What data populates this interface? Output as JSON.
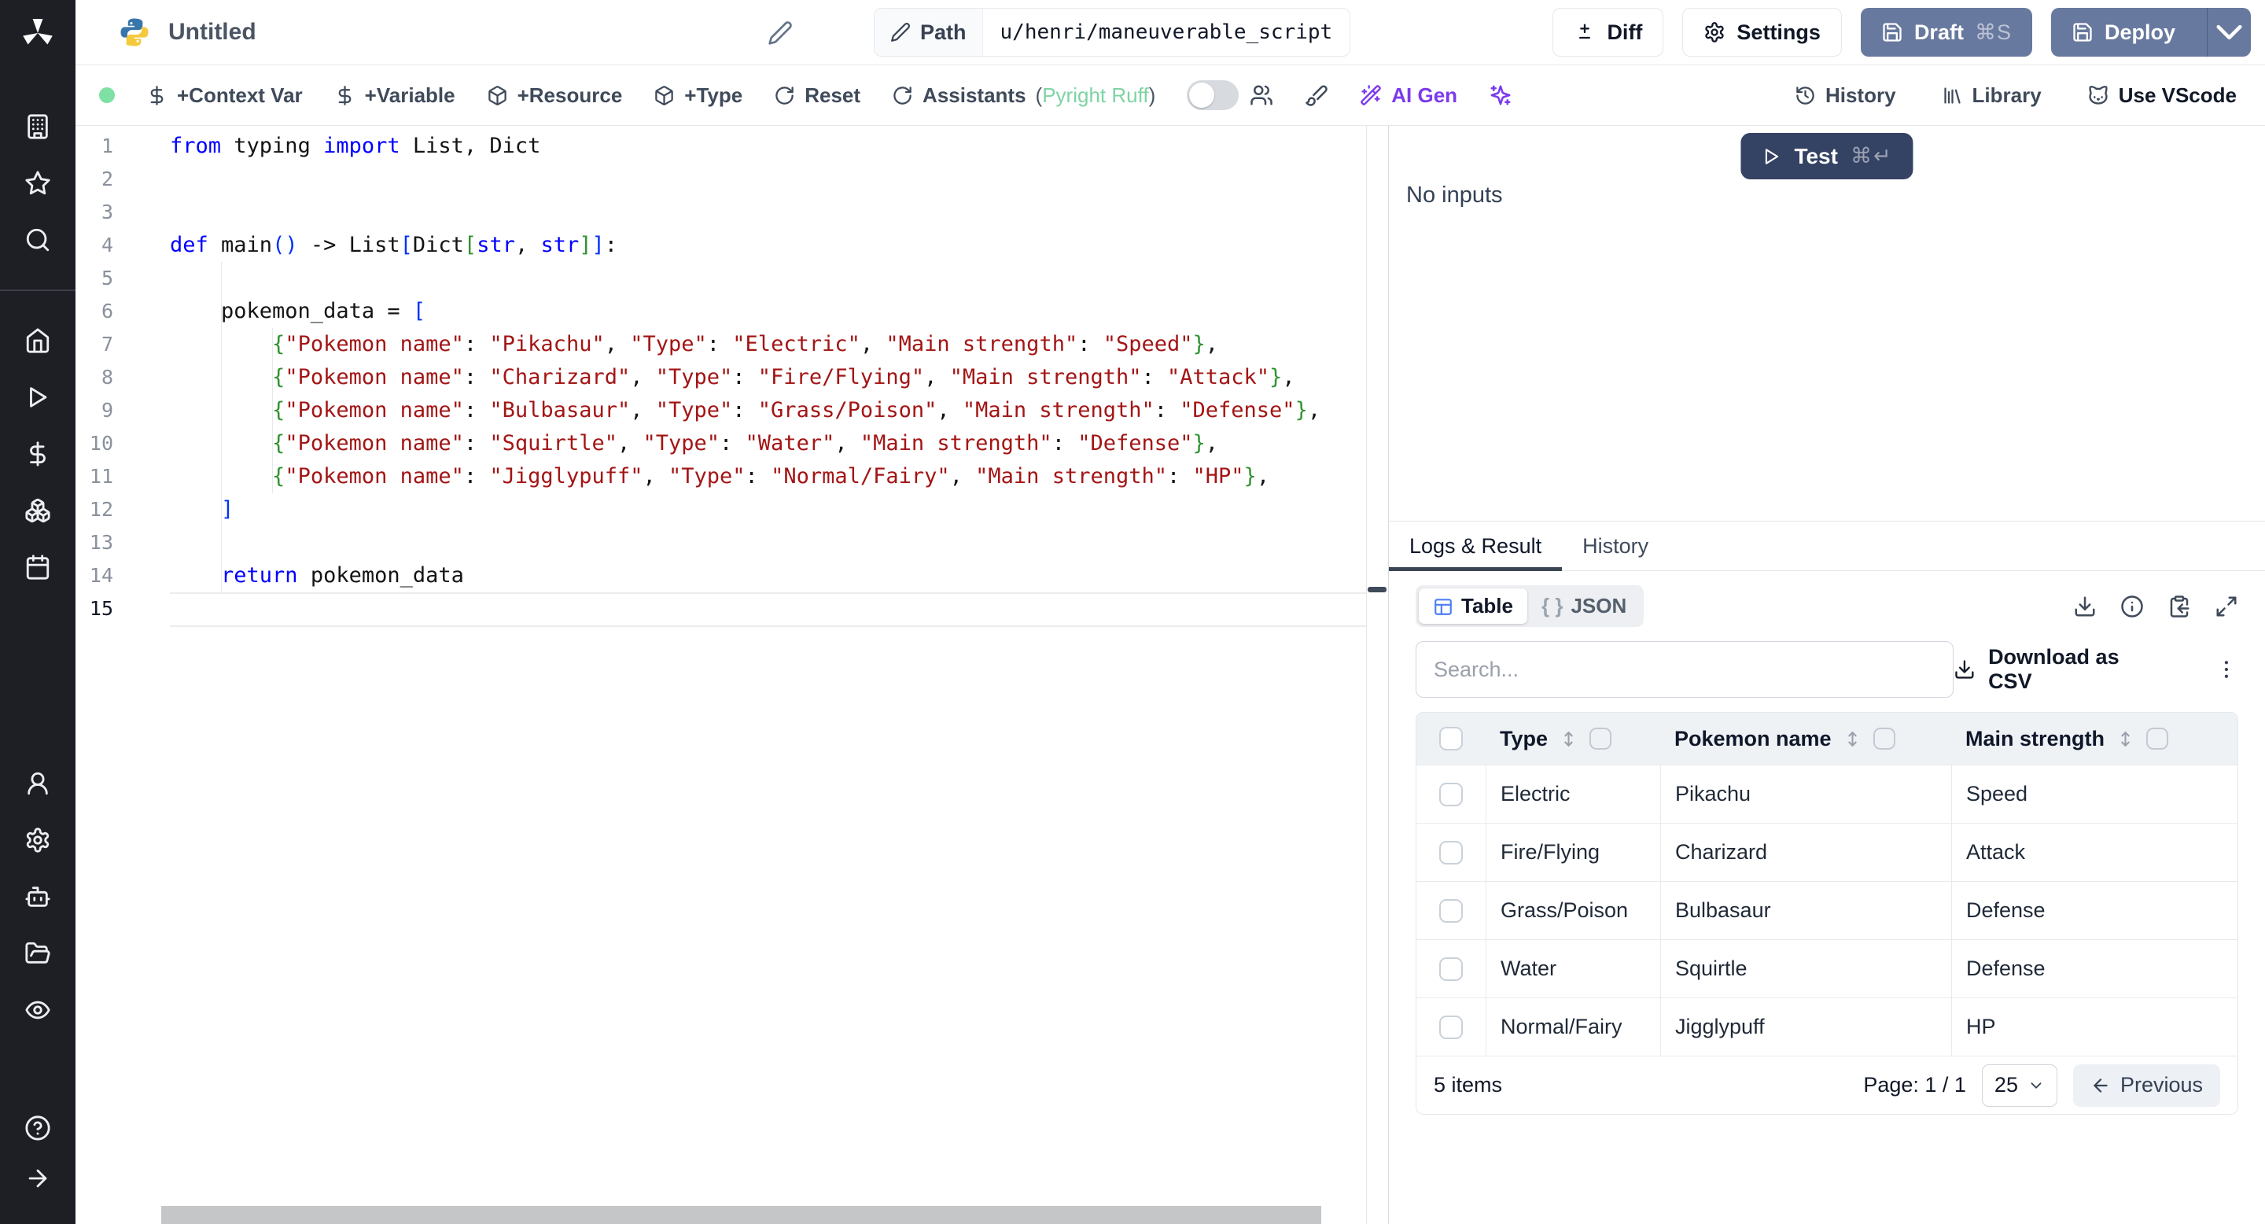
{
  "colors": {
    "accent_slate": "#68799f",
    "test_navy": "#344264",
    "ai_purple": "#7c3aed",
    "assistant_green": "#7fd3a4",
    "status_green": "#7ee0a3"
  },
  "header": {
    "title": "Untitled",
    "path_label": "Path",
    "path_value": "u/henri/maneuverable_script",
    "diff_label": "Diff",
    "settings_label": "Settings",
    "draft_label": "Draft",
    "draft_shortcut": "⌘S",
    "deploy_label": "Deploy"
  },
  "toolbar": {
    "items_left": [
      {
        "icon": "dollar",
        "label": "+Context Var"
      },
      {
        "icon": "dollar",
        "label": "+Variable"
      },
      {
        "icon": "package",
        "label": "+Resource"
      },
      {
        "icon": "package",
        "label": "+Type"
      },
      {
        "icon": "rotate",
        "label": "Reset"
      },
      {
        "icon": "rotate",
        "label": "Assistants"
      }
    ],
    "assistants_suffix": [
      "(",
      "Pyright Ruff",
      ")"
    ],
    "ai_gen_label": "AI Gen",
    "items_right": [
      {
        "icon": "history",
        "label": "History"
      },
      {
        "icon": "library",
        "label": "Library"
      },
      {
        "icon": "cat",
        "label": "Use VScode"
      }
    ]
  },
  "sidebar": {
    "sections": [
      [
        "building",
        "star",
        "search"
      ],
      [
        "home",
        "play",
        "dollar",
        "boxes",
        "calendar"
      ],
      [
        "user",
        "gear",
        "bot",
        "folder",
        "eye"
      ],
      [
        "help",
        "arrow-right"
      ]
    ]
  },
  "editor": {
    "active_line": 15,
    "lines": [
      [
        [
          "k",
          "from"
        ],
        [
          "t",
          " typing "
        ],
        [
          "k",
          "import"
        ],
        [
          "t",
          " List, Dict"
        ]
      ],
      [],
      [],
      [
        [
          "k",
          "def"
        ],
        [
          "t",
          " main"
        ],
        [
          "pb",
          "()"
        ],
        [
          "t",
          " -> List"
        ],
        [
          "pb",
          "["
        ],
        [
          "t",
          "Dict"
        ],
        [
          "pg",
          "["
        ],
        [
          "k",
          "str"
        ],
        [
          "t",
          ", "
        ],
        [
          "k",
          "str"
        ],
        [
          "pg",
          "]"
        ],
        [
          "pb",
          "]"
        ],
        [
          "t",
          ":"
        ]
      ],
      [],
      [
        [
          "t",
          "    pokemon_data = "
        ],
        [
          "pb",
          "["
        ]
      ],
      [
        [
          "t",
          "        "
        ],
        [
          "pg",
          "{"
        ],
        [
          "s",
          "\"Pokemon name\""
        ],
        [
          "t",
          ": "
        ],
        [
          "s",
          "\"Pikachu\""
        ],
        [
          "t",
          ", "
        ],
        [
          "s",
          "\"Type\""
        ],
        [
          "t",
          ": "
        ],
        [
          "s",
          "\"Electric\""
        ],
        [
          "t",
          ", "
        ],
        [
          "s",
          "\"Main strength\""
        ],
        [
          "t",
          ": "
        ],
        [
          "s",
          "\"Speed\""
        ],
        [
          "pg",
          "}"
        ],
        [
          "t",
          ","
        ]
      ],
      [
        [
          "t",
          "        "
        ],
        [
          "pg",
          "{"
        ],
        [
          "s",
          "\"Pokemon name\""
        ],
        [
          "t",
          ": "
        ],
        [
          "s",
          "\"Charizard\""
        ],
        [
          "t",
          ", "
        ],
        [
          "s",
          "\"Type\""
        ],
        [
          "t",
          ": "
        ],
        [
          "s",
          "\"Fire/Flying\""
        ],
        [
          "t",
          ", "
        ],
        [
          "s",
          "\"Main strength\""
        ],
        [
          "t",
          ": "
        ],
        [
          "s",
          "\"Attack\""
        ],
        [
          "pg",
          "}"
        ],
        [
          "t",
          ","
        ]
      ],
      [
        [
          "t",
          "        "
        ],
        [
          "pg",
          "{"
        ],
        [
          "s",
          "\"Pokemon name\""
        ],
        [
          "t",
          ": "
        ],
        [
          "s",
          "\"Bulbasaur\""
        ],
        [
          "t",
          ", "
        ],
        [
          "s",
          "\"Type\""
        ],
        [
          "t",
          ": "
        ],
        [
          "s",
          "\"Grass/Poison\""
        ],
        [
          "t",
          ", "
        ],
        [
          "s",
          "\"Main strength\""
        ],
        [
          "t",
          ": "
        ],
        [
          "s",
          "\"Defense\""
        ],
        [
          "pg",
          "}"
        ],
        [
          "t",
          ","
        ]
      ],
      [
        [
          "t",
          "        "
        ],
        [
          "pg",
          "{"
        ],
        [
          "s",
          "\"Pokemon name\""
        ],
        [
          "t",
          ": "
        ],
        [
          "s",
          "\"Squirtle\""
        ],
        [
          "t",
          ", "
        ],
        [
          "s",
          "\"Type\""
        ],
        [
          "t",
          ": "
        ],
        [
          "s",
          "\"Water\""
        ],
        [
          "t",
          ", "
        ],
        [
          "s",
          "\"Main strength\""
        ],
        [
          "t",
          ": "
        ],
        [
          "s",
          "\"Defense\""
        ],
        [
          "pg",
          "}"
        ],
        [
          "t",
          ","
        ]
      ],
      [
        [
          "t",
          "        "
        ],
        [
          "pg",
          "{"
        ],
        [
          "s",
          "\"Pokemon name\""
        ],
        [
          "t",
          ": "
        ],
        [
          "s",
          "\"Jigglypuff\""
        ],
        [
          "t",
          ", "
        ],
        [
          "s",
          "\"Type\""
        ],
        [
          "t",
          ": "
        ],
        [
          "s",
          "\"Normal/Fairy\""
        ],
        [
          "t",
          ", "
        ],
        [
          "s",
          "\"Main strength\""
        ],
        [
          "t",
          ": "
        ],
        [
          "s",
          "\"HP\""
        ],
        [
          "pg",
          "}"
        ],
        [
          "t",
          ","
        ]
      ],
      [
        [
          "t",
          "    "
        ],
        [
          "pb",
          "]"
        ]
      ],
      [],
      [
        [
          "t",
          "    "
        ],
        [
          "k",
          "return"
        ],
        [
          "t",
          " pokemon_data"
        ]
      ],
      []
    ]
  },
  "run": {
    "test_label": "Test",
    "test_shortcut": "⌘↵",
    "no_inputs": "No inputs"
  },
  "result": {
    "tabs": [
      "Logs & Result",
      "History"
    ],
    "views": [
      "Table",
      "JSON"
    ],
    "braces": "{ }",
    "search_placeholder": "Search...",
    "download_csv": "Download as CSV",
    "table": {
      "columns": [
        "Type",
        "Pokemon name",
        "Main strength"
      ],
      "rows": [
        [
          "Electric",
          "Pikachu",
          "Speed"
        ],
        [
          "Fire/Flying",
          "Charizard",
          "Attack"
        ],
        [
          "Grass/Poison",
          "Bulbasaur",
          "Defense"
        ],
        [
          "Water",
          "Squirtle",
          "Defense"
        ],
        [
          "Normal/Fairy",
          "Jigglypuff",
          "HP"
        ]
      ]
    },
    "footer": {
      "count": "5 items",
      "page": "Page: 1 / 1",
      "page_size": "25",
      "previous": "Previous"
    }
  }
}
